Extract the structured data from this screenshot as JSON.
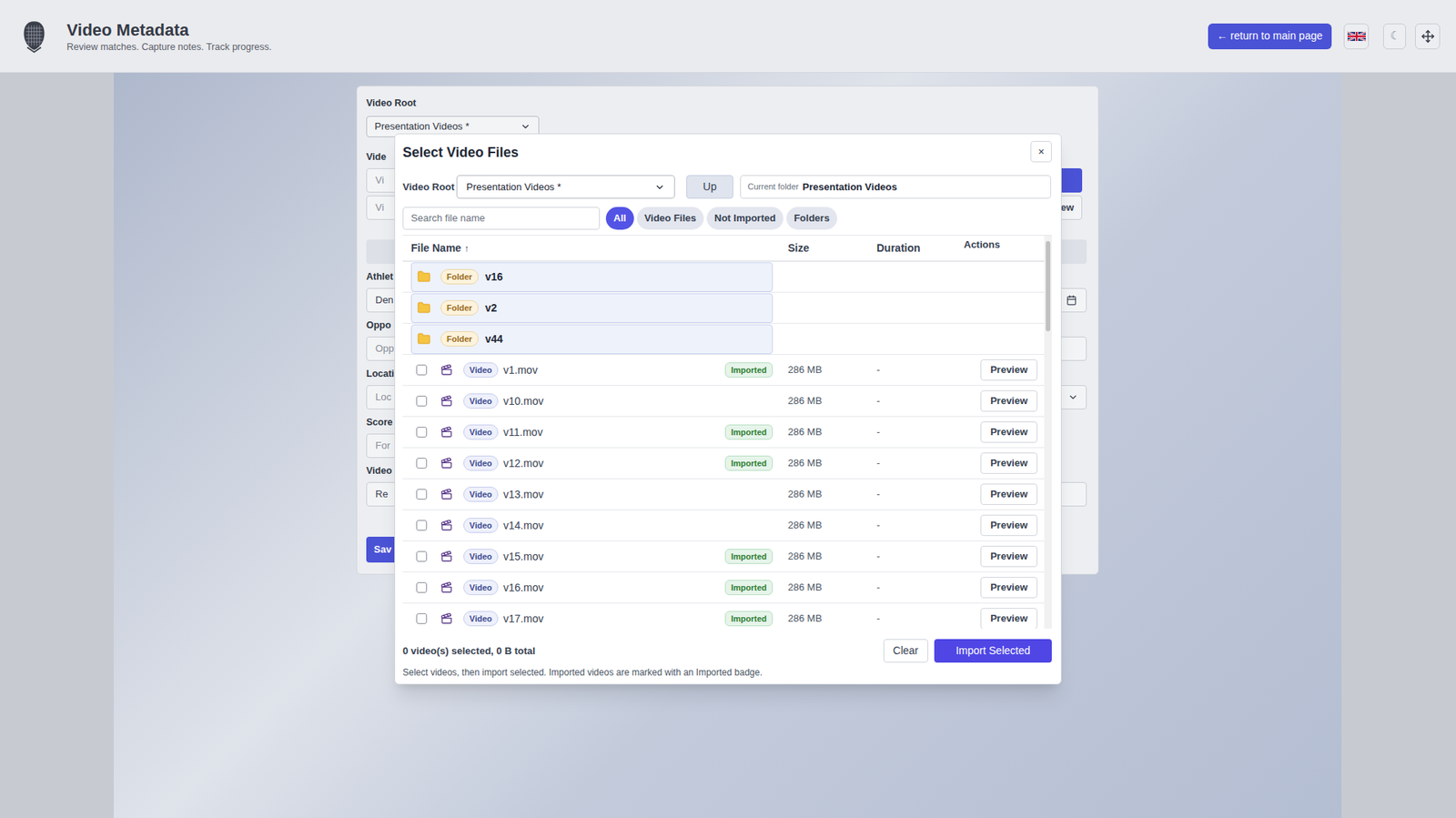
{
  "header": {
    "title": "Video Metadata",
    "subtitle": "Review matches. Capture notes. Track progress.",
    "return_button": "← return to main page",
    "theme_toggle": "☾"
  },
  "background_form": {
    "video_root_label": "Video Root",
    "video_root_value": "Presentation Videos *",
    "rows": [
      {
        "left": {
          "kind": "label",
          "text": "Vide"
        },
        "right": {
          "kind": "none"
        }
      },
      {
        "left": {
          "kind": "input",
          "text": "Vi",
          "placeholder": true
        },
        "right": {
          "kind": "primary"
        }
      },
      {
        "left": {
          "kind": "input",
          "text": "Vi",
          "placeholder": true
        },
        "right": {
          "kind": "button",
          "text": "ew"
        }
      },
      {
        "left": {
          "kind": "bar"
        },
        "right": {
          "kind": "bar"
        }
      },
      {
        "left": {
          "kind": "label",
          "text": "Athlet"
        },
        "right": {
          "kind": "none"
        }
      },
      {
        "left": {
          "kind": "input",
          "text": "Den",
          "placeholder": false
        },
        "right": {
          "kind": "date"
        }
      },
      {
        "left": {
          "kind": "label",
          "text": "Oppo"
        },
        "right": {
          "kind": "none"
        }
      },
      {
        "left": {
          "kind": "input",
          "text": "Opp",
          "placeholder": true
        },
        "right": {
          "kind": "input"
        }
      },
      {
        "left": {
          "kind": "label",
          "text": "Locati"
        },
        "right": {
          "kind": "none"
        }
      },
      {
        "left": {
          "kind": "input",
          "text": "Loc",
          "placeholder": true
        },
        "right": {
          "kind": "select"
        }
      },
      {
        "left": {
          "kind": "label",
          "text": "Score"
        },
        "right": {
          "kind": "none"
        }
      },
      {
        "left": {
          "kind": "input",
          "text": "For",
          "placeholder": true
        },
        "right": {
          "kind": "none"
        }
      },
      {
        "left": {
          "kind": "label",
          "text": "Video"
        },
        "right": {
          "kind": "none"
        }
      },
      {
        "left": {
          "kind": "input",
          "text": "Re",
          "placeholder": false
        },
        "right": {
          "kind": "input"
        }
      },
      {
        "left": {
          "kind": "primary",
          "text": "Sav"
        },
        "right": {
          "kind": "none"
        }
      }
    ]
  },
  "dialog": {
    "title": "Select Video Files",
    "close": "×",
    "root_label": "Video Root",
    "root_value": "Presentation Videos *",
    "up_button": "Up",
    "current_folder_label": "Current folder",
    "current_folder": "Presentation Videos",
    "search_placeholder": "Search file name",
    "filters": [
      {
        "label": "All",
        "selected": true
      },
      {
        "label": "Video Files",
        "selected": false
      },
      {
        "label": "Not Imported",
        "selected": false
      },
      {
        "label": "Folders",
        "selected": false
      }
    ],
    "table": {
      "columns": [
        "File Name",
        "Size",
        "Duration",
        "Actions"
      ],
      "sort_indicator": "↑",
      "imported_badge": "Imported",
      "rows": [
        {
          "kind": "folder",
          "badge": "Folder",
          "name": "v16"
        },
        {
          "kind": "folder",
          "badge": "Folder",
          "name": "v2"
        },
        {
          "kind": "folder",
          "badge": "Folder",
          "name": "v44"
        },
        {
          "kind": "video",
          "badge": "Video",
          "name": "v1.mov",
          "imported": true,
          "checked": false,
          "size": "286 MB",
          "duration": "-",
          "action": "Preview"
        },
        {
          "kind": "video",
          "badge": "Video",
          "name": "v10.mov",
          "imported": false,
          "checked": false,
          "size": "286 MB",
          "duration": "-",
          "action": "Preview"
        },
        {
          "kind": "video",
          "badge": "Video",
          "name": "v11.mov",
          "imported": true,
          "checked": false,
          "size": "286 MB",
          "duration": "-",
          "action": "Preview"
        },
        {
          "kind": "video",
          "badge": "Video",
          "name": "v12.mov",
          "imported": true,
          "checked": false,
          "size": "286 MB",
          "duration": "-",
          "action": "Preview"
        },
        {
          "kind": "video",
          "badge": "Video",
          "name": "v13.mov",
          "imported": false,
          "checked": false,
          "size": "286 MB",
          "duration": "-",
          "action": "Preview"
        },
        {
          "kind": "video",
          "badge": "Video",
          "name": "v14.mov",
          "imported": false,
          "checked": false,
          "size": "286 MB",
          "duration": "-",
          "action": "Preview"
        },
        {
          "kind": "video",
          "badge": "Video",
          "name": "v15.mov",
          "imported": true,
          "checked": false,
          "size": "286 MB",
          "duration": "-",
          "action": "Preview"
        },
        {
          "kind": "video",
          "badge": "Video",
          "name": "v16.mov",
          "imported": true,
          "checked": false,
          "size": "286 MB",
          "duration": "-",
          "action": "Preview"
        },
        {
          "kind": "video",
          "badge": "Video",
          "name": "v17.mov",
          "imported": true,
          "checked": false,
          "size": "286 MB",
          "duration": "-",
          "action": "Preview"
        }
      ]
    },
    "footer": {
      "summary": "0 video(s) selected, 0 B total",
      "hint": "Select videos, then import selected. Imported videos are marked with an Imported badge.",
      "clear": "Clear",
      "import": "Import Selected"
    }
  }
}
